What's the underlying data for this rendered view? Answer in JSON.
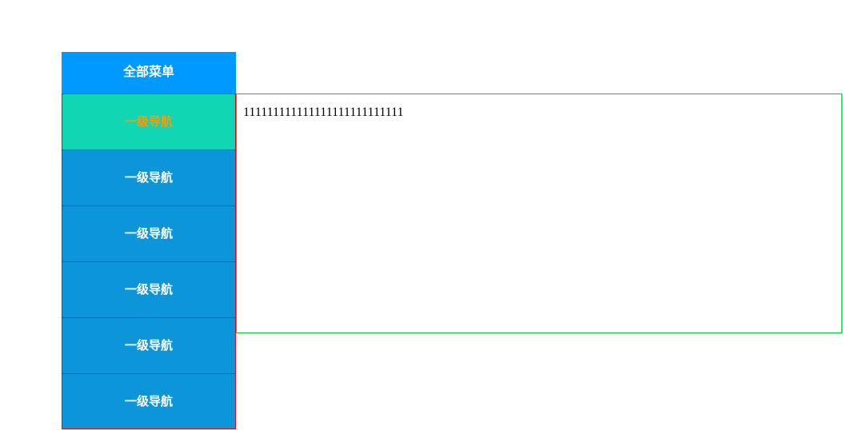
{
  "sidebar": {
    "header": "全部菜单",
    "items": [
      {
        "label": "一级导航",
        "active": true
      },
      {
        "label": "一级导航",
        "active": false
      },
      {
        "label": "一级导航",
        "active": false
      },
      {
        "label": "一级导航",
        "active": false
      },
      {
        "label": "一级导航",
        "active": false
      },
      {
        "label": "一级导航",
        "active": false
      }
    ]
  },
  "flyout": {
    "content": "111111111111111111111111111"
  }
}
